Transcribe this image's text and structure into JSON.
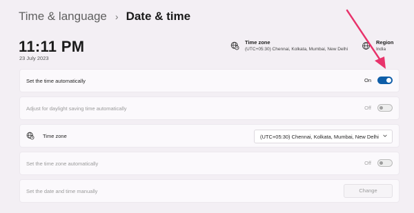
{
  "header": {
    "parent": "Time & language",
    "current": "Date & time"
  },
  "clock": {
    "time": "11:11 PM",
    "date": "23 July 2023"
  },
  "timezone_info": {
    "title": "Time zone",
    "value": "(UTC+05:30) Chennai, Kolkata, Mumbai, New Delhi"
  },
  "region_info": {
    "title": "Region",
    "value": "India"
  },
  "settings": {
    "set_time_auto": {
      "label": "Set the time automatically",
      "state": "On"
    },
    "dst_auto": {
      "label": "Adjust for daylight saving time automatically",
      "state": "Off"
    },
    "time_zone": {
      "label": "Time zone",
      "selected": "(UTC+05:30) Chennai, Kolkata, Mumbai, New Delhi"
    },
    "tz_auto": {
      "label": "Set the time zone automatically",
      "state": "Off"
    },
    "manual": {
      "label": "Set the date and time manually",
      "button": "Change"
    }
  },
  "colors": {
    "accent": "#0f5ea8",
    "annotation_arrow": "#e8336b"
  }
}
